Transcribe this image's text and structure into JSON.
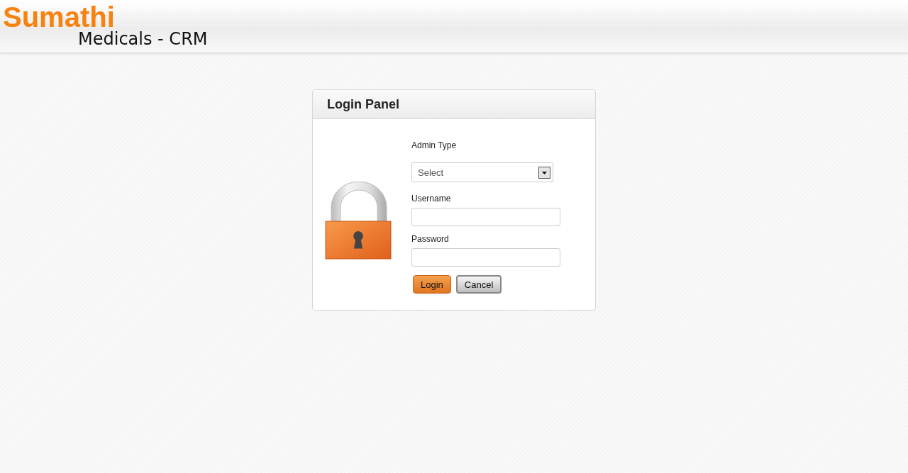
{
  "header": {
    "brand": "Sumathi",
    "subtitle": "Medicals - CRM"
  },
  "panel": {
    "title": "Login Panel",
    "fields": [
      {
        "kind": "select",
        "label": "Admin Type",
        "value": "Select"
      },
      {
        "kind": "text",
        "label": "Username"
      },
      {
        "kind": "password",
        "label": "Password"
      }
    ],
    "buttons": [
      {
        "label": "Login",
        "kind": "primary"
      },
      {
        "label": "Cancel",
        "kind": "secondary"
      }
    ]
  }
}
